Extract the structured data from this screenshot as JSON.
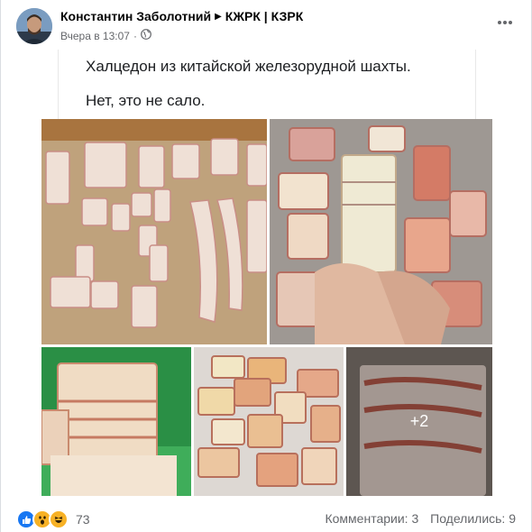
{
  "post": {
    "author": "Константин Заболотний",
    "group": "КЖРК | КЗРК",
    "time": "Вчера в 13:07",
    "privacy_icon": "globe-icon",
    "more_icon": "ellipsis-icon"
  },
  "quote": {
    "line1": "Халцедон из китайской железорудной шахты.",
    "line2": "Нет, это не сало."
  },
  "gallery": {
    "more_count": "+2"
  },
  "footer": {
    "reaction_icons": [
      "like-icon",
      "wow-icon",
      "haha-icon"
    ],
    "reaction_count": "73",
    "comments": "Комментарии: 3",
    "shares": "Поделились: 9"
  },
  "colors": {
    "like": "#1877f2",
    "emoji": "#f7b125",
    "secondary_text": "#65676b"
  }
}
